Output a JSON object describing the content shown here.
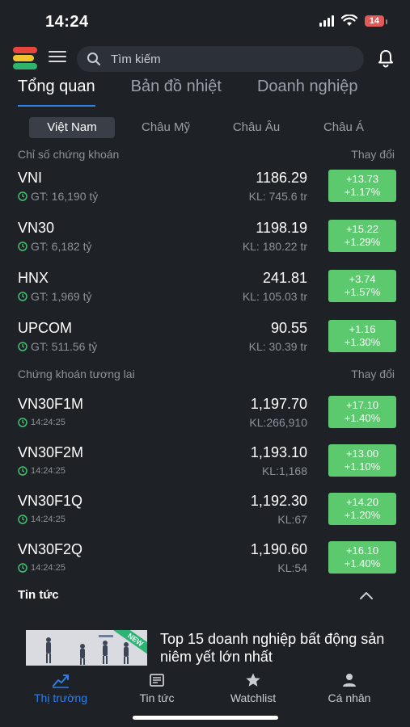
{
  "status_bar": {
    "time": "14:24",
    "battery": "14"
  },
  "search": {
    "placeholder": "Tìm kiếm"
  },
  "main_tabs": [
    {
      "label": "Tổng quan",
      "active": true
    },
    {
      "label": "Bản đồ nhiệt",
      "active": false
    },
    {
      "label": "Doanh nghiệp",
      "active": false
    }
  ],
  "region_tabs": [
    {
      "label": "Việt Nam",
      "active": true
    },
    {
      "label": "Châu Mỹ",
      "active": false
    },
    {
      "label": "Châu Âu",
      "active": false
    },
    {
      "label": "Châu Á",
      "active": false
    }
  ],
  "indices": {
    "header": "Chỉ số chứng khoán",
    "change_header": "Thay đổi",
    "rows": [
      {
        "name": "VNI",
        "sub": "GT: 16,190 tỷ",
        "value": "1186.29",
        "vol": "KL: 745.6 tr",
        "change": "+13.73",
        "pct": "+1.17%"
      },
      {
        "name": "VN30",
        "sub": "GT: 6,182 tỷ",
        "value": "1198.19",
        "vol": "KL: 180.22 tr",
        "change": "+15.22",
        "pct": "+1.29%"
      },
      {
        "name": "HNX",
        "sub": "GT: 1,969 tỷ",
        "value": "241.81",
        "vol": "KL: 105.03 tr",
        "change": "+3.74",
        "pct": "+1.57%"
      },
      {
        "name": "UPCOM",
        "sub": "GT: 511.56 tỷ",
        "value": "90.55",
        "vol": "KL: 30.39 tr",
        "change": "+1.16",
        "pct": "+1.30%"
      }
    ]
  },
  "futures": {
    "header": "Chứng khoán tương lai",
    "change_header": "Thay đổi",
    "rows": [
      {
        "name": "VN30F1M",
        "sub": "14:24:25",
        "value": "1,197.70",
        "vol": "KL:266,910",
        "change": "+17.10",
        "pct": "+1.40%"
      },
      {
        "name": "VN30F2M",
        "sub": "14:24:25",
        "value": "1,193.10",
        "vol": "KL:1,168",
        "change": "+13.00",
        "pct": "+1.10%"
      },
      {
        "name": "VN30F1Q",
        "sub": "14:24:25",
        "value": "1,192.30",
        "vol": "KL:67",
        "change": "+14.20",
        "pct": "+1.20%"
      },
      {
        "name": "VN30F2Q",
        "sub": "14:24:25",
        "value": "1,190.60",
        "vol": "KL:54",
        "change": "+16.10",
        "pct": "+1.40%"
      }
    ]
  },
  "news": {
    "title": "Tin tức",
    "items": [
      {
        "badge": "NEW",
        "headline": "Top 15 doanh nghiệp bất động sản niêm yết lớn nhất"
      }
    ]
  },
  "bottom_nav": [
    {
      "label": "Thị trường",
      "icon": "chart-icon",
      "active": true
    },
    {
      "label": "Tin tức",
      "icon": "newspaper-icon",
      "active": false
    },
    {
      "label": "Watchlist",
      "icon": "star-icon",
      "active": false
    },
    {
      "label": "Cá nhân",
      "icon": "person-icon",
      "active": false
    }
  ],
  "colors": {
    "background": "#1e2126",
    "accent": "#2f7fe8",
    "positive": "#5cc96e",
    "clock": "#3ec46d"
  }
}
